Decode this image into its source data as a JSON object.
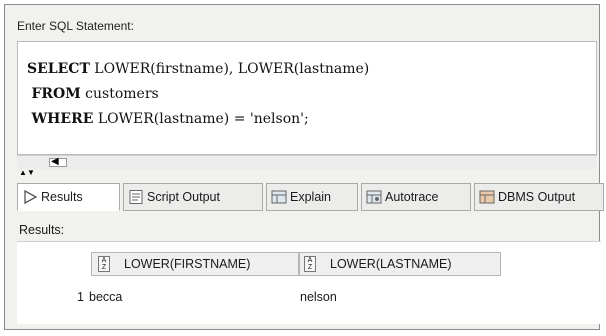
{
  "editor": {
    "label": "Enter SQL Statement:",
    "lines": [
      {
        "keyword": "SELECT",
        "rest": " LOWER(firstname), LOWER(lastname)"
      },
      {
        "keyword": "FROM",
        "rest": " customers"
      },
      {
        "keyword": "WHERE",
        "rest": " LOWER(lastname) = 'nelson';"
      }
    ]
  },
  "tabs": [
    {
      "label": "Results",
      "icon": "play-triangle-icon"
    },
    {
      "label": "Script Output",
      "icon": "script-output-icon"
    },
    {
      "label": "Explain",
      "icon": "explain-plan-icon"
    },
    {
      "label": "Autotrace",
      "icon": "autotrace-icon"
    },
    {
      "label": "DBMS Output",
      "icon": "dbms-output-icon"
    }
  ],
  "results": {
    "label": "Results:",
    "columns": [
      "LOWER(FIRSTNAME)",
      "LOWER(LASTNAME)"
    ],
    "rows": [
      {
        "num": "1",
        "cells": [
          "becca",
          "nelson"
        ]
      }
    ]
  },
  "colors": {
    "frame_bg": "#f1f1ee",
    "border": "#8c8c8c",
    "grid_bg": "#ffffff"
  }
}
